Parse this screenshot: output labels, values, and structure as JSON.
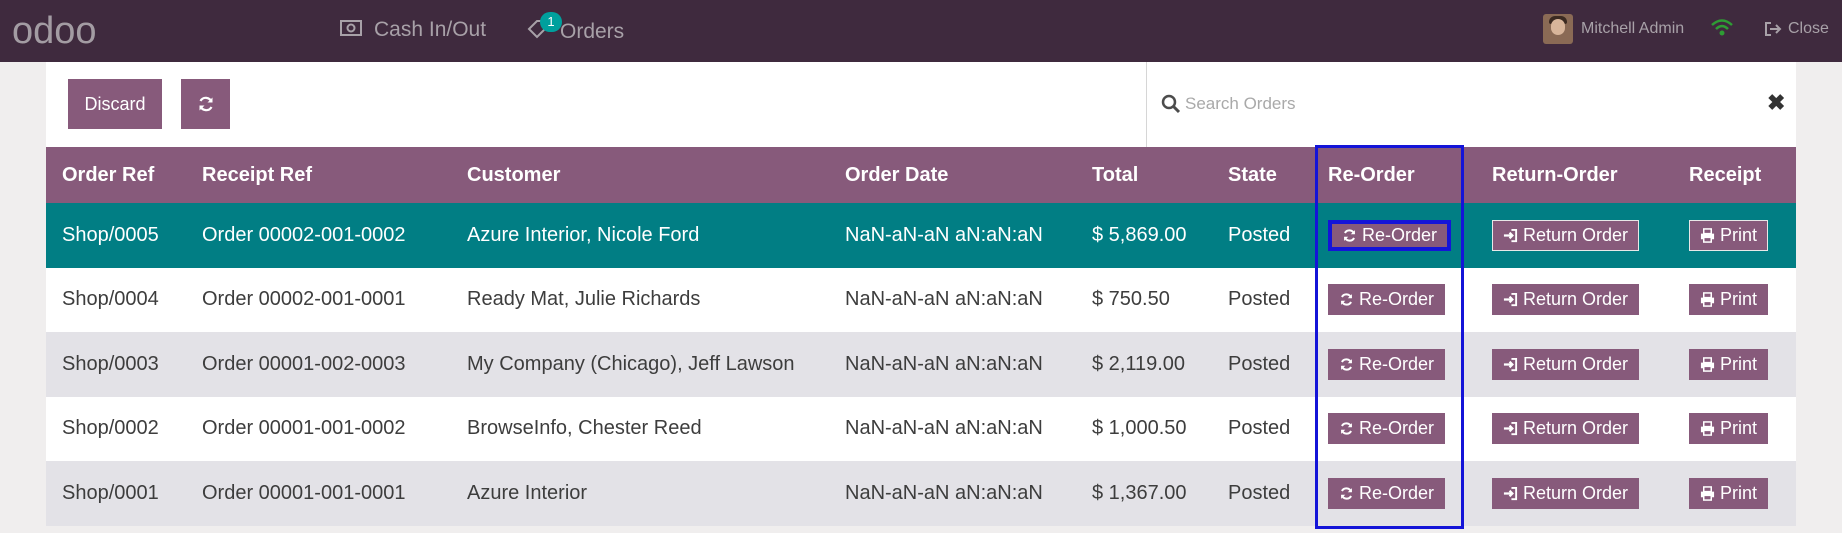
{
  "app": {
    "logo": "odoo",
    "nav": {
      "cash_label": "Cash In/Out",
      "orders_label": "Orders",
      "orders_badge": "1"
    },
    "user_name": "Mitchell Admin",
    "close_label": "Close"
  },
  "toolbar": {
    "discard_label": "Discard",
    "refresh_icon": "refresh-icon"
  },
  "search": {
    "placeholder": "Search Orders",
    "value": ""
  },
  "table": {
    "headers": [
      "Order Ref",
      "Receipt Ref",
      "Customer",
      "Order Date",
      "Total",
      "State",
      "Re-Order",
      "Return-Order",
      "Receipt"
    ],
    "action_labels": {
      "reorder": "Re-Order",
      "return": "Return Order",
      "print": "Print"
    },
    "rows": [
      {
        "order_ref": "Shop/0005",
        "receipt_ref": "Order 00002-001-0002",
        "customer": "Azure Interior, Nicole Ford",
        "order_date": "NaN-aN-aN aN:aN:aN",
        "total": "$ 5,869.00",
        "state": "Posted"
      },
      {
        "order_ref": "Shop/0004",
        "receipt_ref": "Order 00002-001-0001",
        "customer": "Ready Mat, Julie Richards",
        "order_date": "NaN-aN-aN aN:aN:aN",
        "total": "$ 750.50",
        "state": "Posted"
      },
      {
        "order_ref": "Shop/0003",
        "receipt_ref": "Order 00001-002-0003",
        "customer": "My Company (Chicago), Jeff Lawson",
        "order_date": "NaN-aN-aN aN:aN:aN",
        "total": "$ 2,119.00",
        "state": "Posted"
      },
      {
        "order_ref": "Shop/0002",
        "receipt_ref": "Order 00001-001-0002",
        "customer": "BrowseInfo, Chester Reed",
        "order_date": "NaN-aN-aN aN:aN:aN",
        "total": "$ 1,000.50",
        "state": "Posted"
      },
      {
        "order_ref": "Shop/0001",
        "receipt_ref": "Order 00001-001-0001",
        "customer": "Azure Interior",
        "order_date": "NaN-aN-aN aN:aN:aN",
        "total": "$ 1,367.00",
        "state": "Posted"
      }
    ]
  },
  "colors": {
    "topbar": "#3f2a3e",
    "brand_purple": "#875a7b",
    "selected_row": "#017e84",
    "highlight": "#1414d8"
  }
}
